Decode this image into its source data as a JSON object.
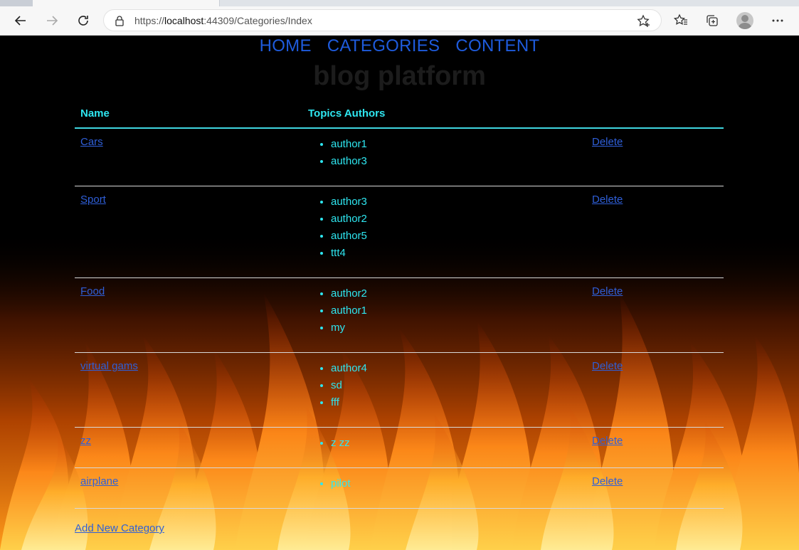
{
  "browser": {
    "url_prefix": "https://",
    "url_host": "localhost",
    "url_rest": ":44309/Categories/Index"
  },
  "nav": {
    "items": [
      "HOME",
      "CATEGORIES",
      "CONTENT"
    ]
  },
  "brand": "blog platform",
  "table": {
    "columns": [
      "Name",
      "Topics Authors"
    ],
    "delete_label": "Delete",
    "rows": [
      {
        "name": "Cars",
        "authors": [
          "author1",
          "author3"
        ]
      },
      {
        "name": "Sport",
        "authors": [
          "author3",
          "author2",
          "author5",
          "ttt4"
        ]
      },
      {
        "name": "Food",
        "authors": [
          "author2",
          "author1",
          "my"
        ]
      },
      {
        "name": "virtual gams",
        "authors": [
          "author4",
          "sd",
          "fff"
        ]
      },
      {
        "name": "zz",
        "authors": [
          "z zz"
        ]
      },
      {
        "name": "airplane",
        "authors": [
          "pilot"
        ]
      }
    ]
  },
  "add_link": "Add New Category",
  "colors": {
    "link": "#2f5fd8",
    "accent": "#2ee6f0",
    "nav": "#1e5bdc"
  }
}
